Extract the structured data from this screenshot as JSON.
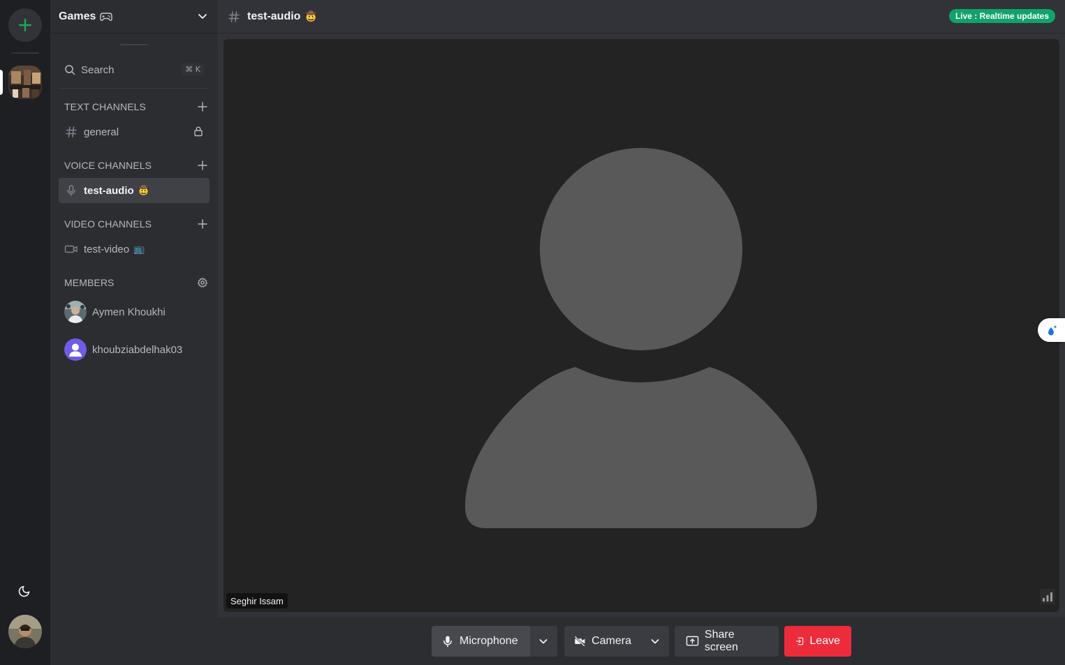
{
  "server": {
    "name": "Games",
    "name_emoji": "🎮"
  },
  "sidebar": {
    "search": {
      "label": "Search",
      "shortcut": "⌘ K"
    },
    "sections": {
      "text": {
        "title": "TEXT CHANNELS"
      },
      "voice": {
        "title": "VOICE CHANNELS"
      },
      "video": {
        "title": "VIDEO CHANNELS"
      },
      "members": {
        "title": "MEMBERS"
      }
    },
    "channels": {
      "general": {
        "name": "general"
      },
      "test_audio": {
        "name": "test-audio",
        "emoji": "🤠"
      },
      "test_video": {
        "name": "test-video",
        "emoji": "📺"
      }
    },
    "members": [
      {
        "name": "Aymen Khoukhi"
      },
      {
        "name": "khoubziabdelhak03"
      }
    ]
  },
  "topbar": {
    "channel_name": "test-audio",
    "channel_emoji": "🤠",
    "live_badge": "Live : Realtime updates"
  },
  "stage": {
    "participant_name": "Seghir Issam"
  },
  "controls": {
    "microphone": "Microphone",
    "camera": "Camera",
    "share_screen": "Share screen",
    "leave": "Leave"
  },
  "colors": {
    "accent_green": "#10a36c",
    "leave_red": "#ed2c3b",
    "add_server_green": "#23a559",
    "member_avatar_purple": "#6e5ce7"
  },
  "icons": {
    "rail": [
      "plus-icon",
      "moon-icon"
    ],
    "sidebar": [
      "chevron-down-icon",
      "search-icon",
      "plus-icon",
      "hash-icon",
      "lock-icon",
      "microphone-icon",
      "video-camera-icon",
      "gear-icon"
    ],
    "controls": [
      "microphone-icon",
      "chevron-down-icon",
      "camera-off-icon",
      "share-screen-icon",
      "leave-icon"
    ],
    "stage": [
      "person-placeholder-icon",
      "signal-bars-icon"
    ]
  }
}
